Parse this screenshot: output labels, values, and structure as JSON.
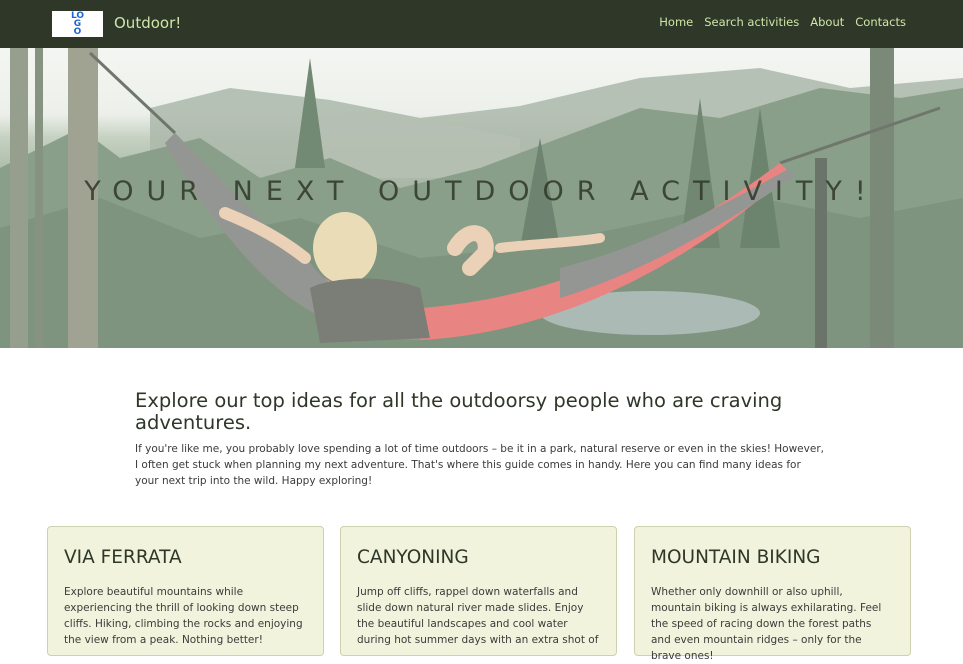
{
  "header": {
    "logo_text": "LOGO",
    "brand": "Outdoor!",
    "nav": [
      "Home",
      "Search activities",
      "About",
      "Contacts"
    ]
  },
  "hero": {
    "title": "YOUR NEXT OUTDOOR ACTIVITY!",
    "image": "hammock-forest-photo"
  },
  "intro": {
    "heading": "Explore our top ideas for all the outdoorsy people who are craving adventures.",
    "body": "If you're like me, you probably love spending a lot of time outdoors – be it in a park, natural reserve or even in the skies! However, I often get stuck when planning my next adventure. That's where this guide comes in handy. Here you can find many ideas for your next trip into the wild. Happy exploring!"
  },
  "cards": [
    {
      "title": "VIA FERRATA",
      "text": "Explore beautiful mountains while experiencing the thrill of looking down steep cliffs. Hiking, climbing the rocks and enjoying the view from a peak. Nothing better!"
    },
    {
      "title": "CANYONING",
      "text": "Jump off cliffs, rappel down waterfalls and slide down natural river made slides. Enjoy the beautiful landscapes and cool water during hot summer days with an extra shot of"
    },
    {
      "title": "MOUNTAIN BIKING",
      "text": "Whether only downhill or also uphill, mountain biking is always exhilarating. Feel the speed of racing down the forest paths and even mountain ridges – only for the brave ones!"
    }
  ],
  "colors": {
    "navbar": "#2f3728",
    "nav_text": "#cfe6a8",
    "card_bg": "#f2f3dc",
    "logo_blue": "#1c63d4"
  }
}
